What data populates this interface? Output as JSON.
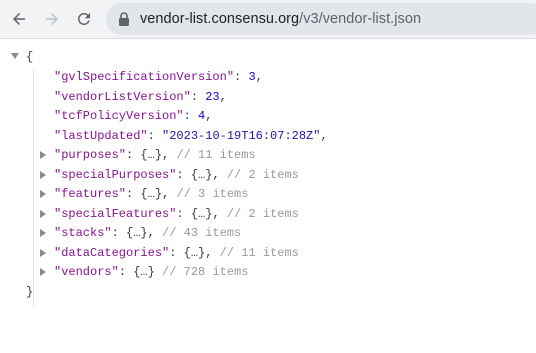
{
  "browser": {
    "url_host": "vendor-list.consensu.org",
    "url_path": "/v3/vendor-list.json"
  },
  "json": {
    "open_brace": "{",
    "close_brace": "}",
    "scalars": [
      {
        "key": "\"gvlSpecificationVersion\"",
        "value": "3"
      },
      {
        "key": "\"vendorListVersion\"",
        "value": "23"
      },
      {
        "key": "\"tcfPolicyVersion\"",
        "value": "4"
      },
      {
        "key": "\"lastUpdated\"",
        "value": "\"2023-10-19T16:07:28Z\""
      }
    ],
    "collapsed": [
      {
        "key": "\"purposes\"",
        "preview": "{…}",
        "comment": "// 11 items"
      },
      {
        "key": "\"specialPurposes\"",
        "preview": "{…}",
        "comment": "// 2 items"
      },
      {
        "key": "\"features\"",
        "preview": "{…}",
        "comment": "// 3 items"
      },
      {
        "key": "\"specialFeatures\"",
        "preview": "{…}",
        "comment": "// 2 items"
      },
      {
        "key": "\"stacks\"",
        "preview": "{…}",
        "comment": "// 43 items"
      },
      {
        "key": "\"dataCategories\"",
        "preview": "{…}",
        "comment": "// 11 items"
      },
      {
        "key": "\"vendors\"",
        "preview": "{…}",
        "comment": "// 728 items"
      }
    ]
  }
}
